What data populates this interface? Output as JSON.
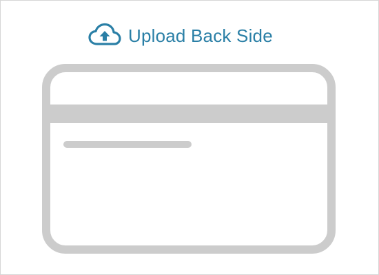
{
  "upload": {
    "label": "Upload Back Side",
    "icon": "cloud-upload-icon"
  },
  "card_illustration": {
    "description_icon": "credit-card-back-icon"
  },
  "colors": {
    "accent": "#2a7fa6",
    "card_gray": "#cccccc",
    "frame_border": "#d6d6d6",
    "background": "#ffffff"
  }
}
